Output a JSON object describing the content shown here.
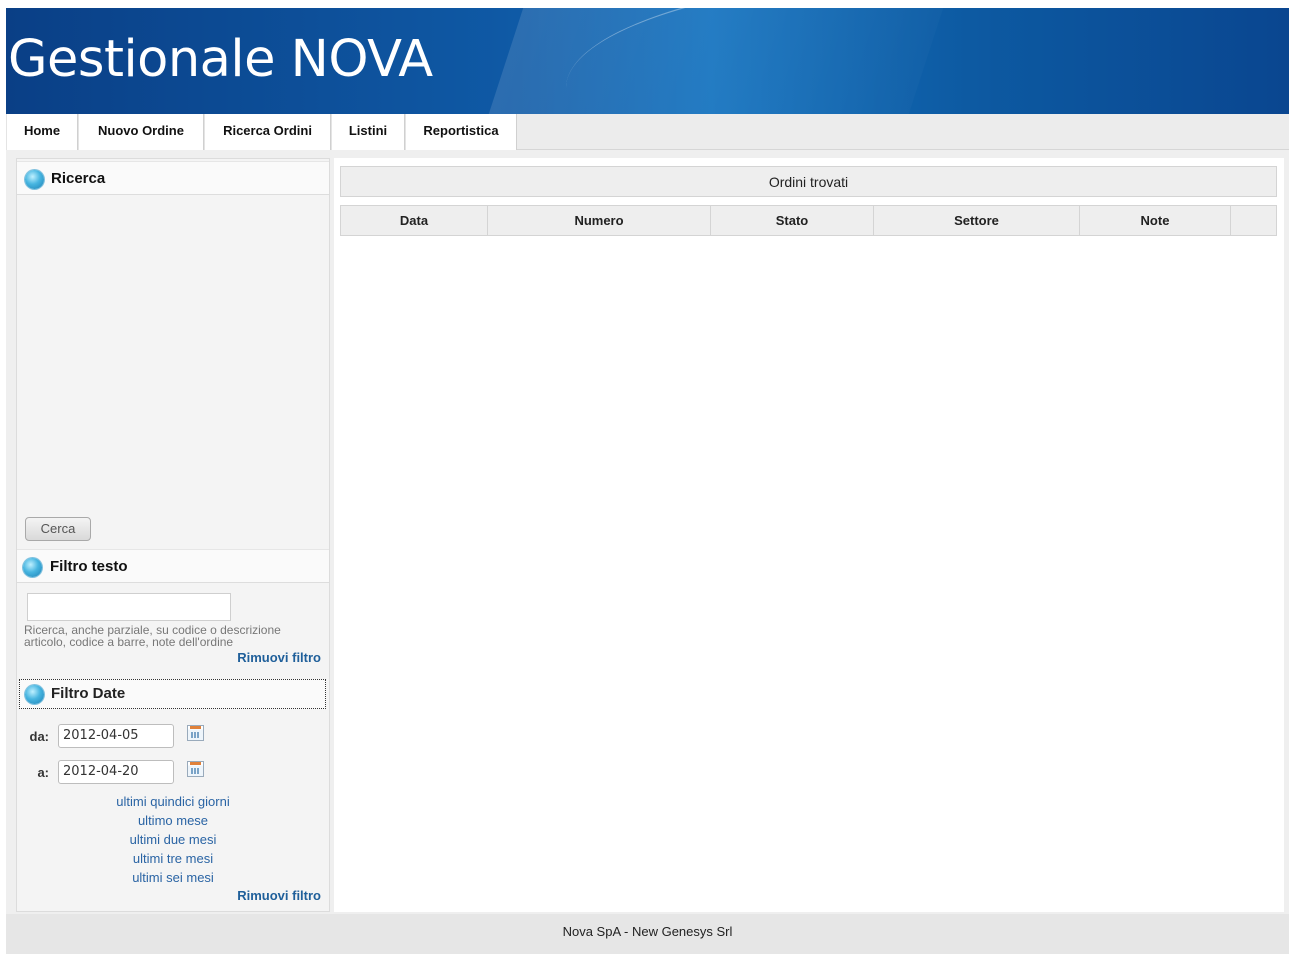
{
  "header": {
    "title": "Gestionale NOVA"
  },
  "nav": {
    "tabs": [
      {
        "label": "Home"
      },
      {
        "label": "Nuovo Ordine"
      },
      {
        "label": "Ricerca Ordini"
      },
      {
        "label": "Listini"
      },
      {
        "label": "Reportistica"
      }
    ]
  },
  "sidebar": {
    "ricerca": {
      "title": "Ricerca",
      "button": "Cerca"
    },
    "filtro_testo": {
      "title": "Filtro testo",
      "value": "",
      "help": "Ricerca, anche parziale, su codice o descrizione articolo, codice a barre, note dell'ordine",
      "remove": "Rimuovi filtro"
    },
    "filtro_date": {
      "title": "Filtro Date",
      "from_label": "da:",
      "from_value": "2012-04-05",
      "to_label": "a:",
      "to_value": "2012-04-20",
      "ranges": [
        "ultimi quindici giorni",
        "ultimo mese",
        "ultimi due mesi",
        "ultimi tre mesi",
        "ultimi sei mesi"
      ],
      "remove": "Rimuovi filtro"
    }
  },
  "main": {
    "table_title": "Ordini trovati",
    "columns": [
      "Data",
      "Numero",
      "Stato",
      "Settore",
      "Note",
      ""
    ]
  },
  "footer": {
    "text": "Nova SpA - New Genesys Srl"
  }
}
